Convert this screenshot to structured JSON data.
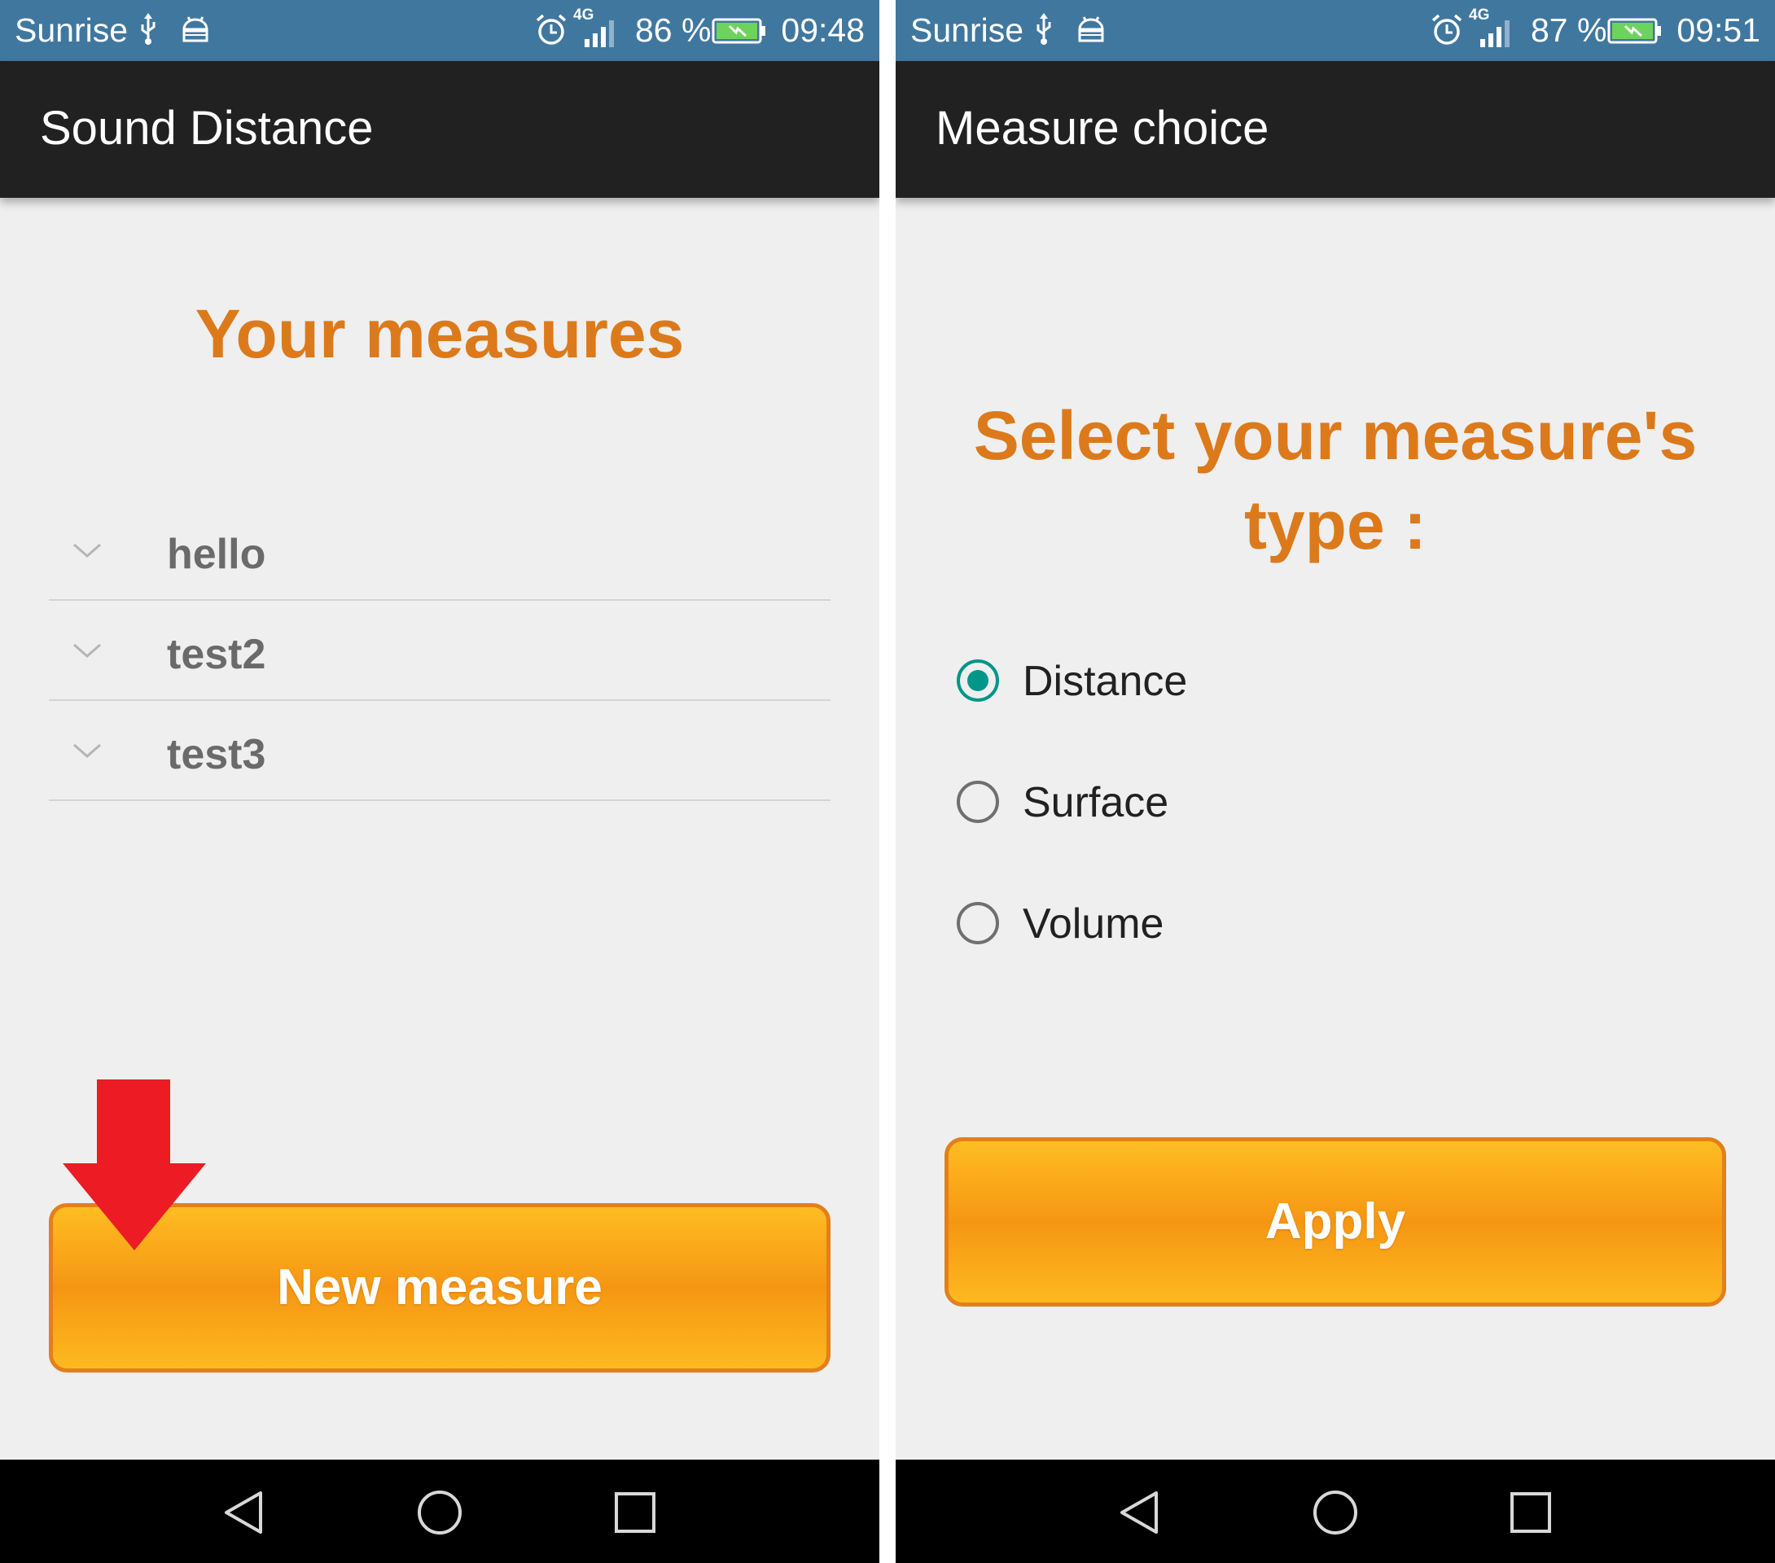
{
  "left_screen": {
    "status": {
      "carrier": "Sunrise",
      "network": "4G",
      "battery": "86 %",
      "time": "09:48"
    },
    "app_title": "Sound Distance",
    "heading": "Your measures",
    "measures": [
      {
        "label": "hello"
      },
      {
        "label": "test2"
      },
      {
        "label": "test3"
      }
    ],
    "primary_button": "New measure"
  },
  "right_screen": {
    "status": {
      "carrier": "Sunrise",
      "network": "4G",
      "battery": "87 %",
      "time": "09:51"
    },
    "app_title": "Measure choice",
    "heading": "Select your measure's type :",
    "options": [
      {
        "label": "Distance",
        "checked": true
      },
      {
        "label": "Surface",
        "checked": false
      },
      {
        "label": "Volume",
        "checked": false
      }
    ],
    "primary_button": "Apply"
  },
  "colors": {
    "status_bar": "#40779f",
    "app_bar": "#212121",
    "heading": "#dc7a1b",
    "button_orange": "#f59613",
    "radio_selected": "#009688",
    "annotation_arrow": "#ed1c24"
  },
  "icons": {
    "status": [
      "usb-icon",
      "android-debug-icon",
      "alarm-icon",
      "signal-icon",
      "battery-charging-icon"
    ],
    "nav": [
      "back-icon",
      "home-icon",
      "recents-icon"
    ],
    "list": "chevron-down-icon",
    "annotation": "red-arrow-down-icon"
  }
}
